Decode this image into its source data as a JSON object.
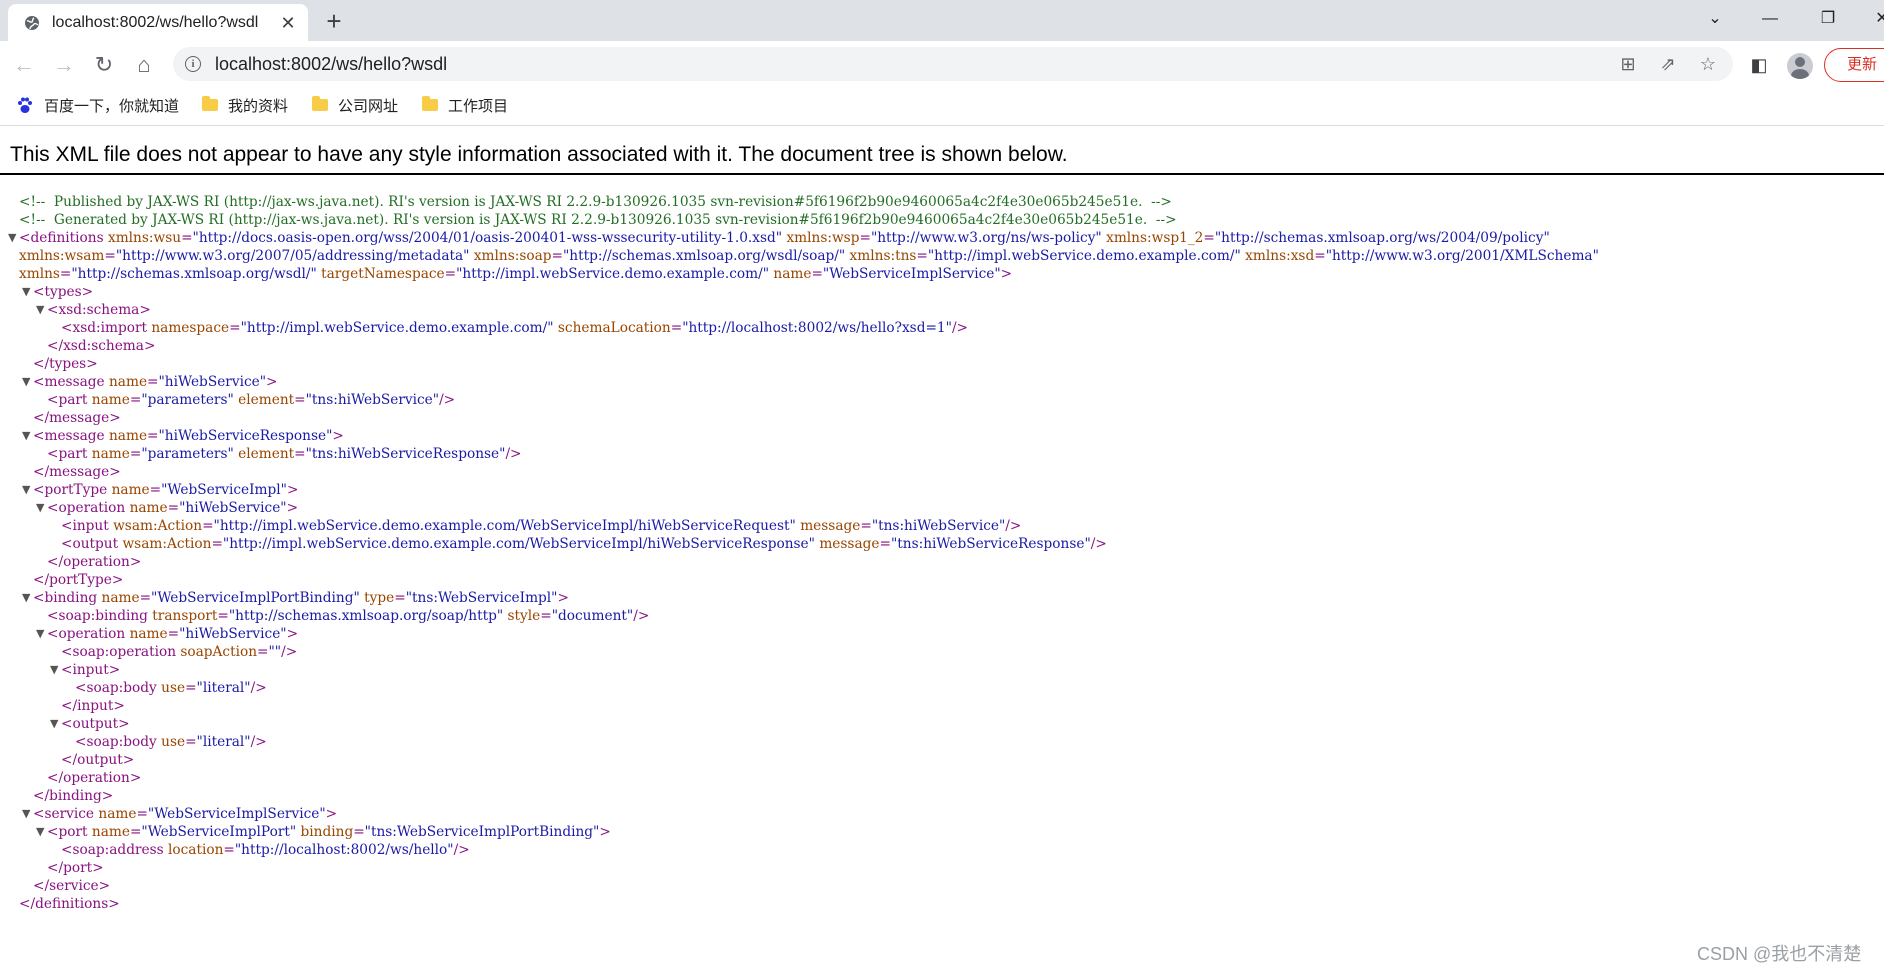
{
  "browser": {
    "tab_title": "localhost:8002/ws/hello?wsdl",
    "url": "localhost:8002/ws/hello?wsdl",
    "update_label": "更新",
    "bookmarks": [
      "百度一下，你就知道",
      "我的资料",
      "公司网址",
      "工作项目"
    ]
  },
  "page": {
    "notice": "This XML file does not appear to have any style information associated with it. The document tree is shown below."
  },
  "xml_lines": [
    "<!--  Published by JAX-WS RI (http://jax-ws.java.net). RI's version is JAX-WS RI 2.2.9-b130926.1035 svn-revision#5f6196f2b90e9460065a4c2f4e30e065b245e51e.  -->",
    "<!--  Generated by JAX-WS RI (http://jax-ws.java.net). RI's version is JAX-WS RI 2.2.9-b130926.1035 svn-revision#5f6196f2b90e9460065a4c2f4e30e065b245e51e.  -->",
    "<definitions xmlns:wsu=\"http://docs.oasis-open.org/wss/2004/01/oasis-200401-wss-wssecurity-utility-1.0.xsd\" xmlns:wsp=\"http://www.w3.org/ns/ws-policy\" xmlns:wsp1_2=\"http://schemas.xmlsoap.org/ws/2004/09/policy\"",
    "xmlns:wsam=\"http://www.w3.org/2007/05/addressing/metadata\" xmlns:soap=\"http://schemas.xmlsoap.org/wsdl/soap/\" xmlns:tns=\"http://impl.webService.demo.example.com/\" xmlns:xsd=\"http://www.w3.org/2001/XMLSchema\"",
    "xmlns=\"http://schemas.xmlsoap.org/wsdl/\" targetNamespace=\"http://impl.webService.demo.example.com/\" name=\"WebServiceImplService\">",
    "<types>",
    "<xsd:schema>",
    "<xsd:import namespace=\"http://impl.webService.demo.example.com/\" schemaLocation=\"http://localhost:8002/ws/hello?xsd=1\"/>",
    "</xsd:schema>",
    "</types>",
    "<message name=\"hiWebService\">",
    "<part name=\"parameters\" element=\"tns:hiWebService\"/>",
    "</message>",
    "<message name=\"hiWebServiceResponse\">",
    "<part name=\"parameters\" element=\"tns:hiWebServiceResponse\"/>",
    "</message>",
    "<portType name=\"WebServiceImpl\">",
    "<operation name=\"hiWebService\">",
    "<input wsam:Action=\"http://impl.webService.demo.example.com/WebServiceImpl/hiWebServiceRequest\" message=\"tns:hiWebService\"/>",
    "<output wsam:Action=\"http://impl.webService.demo.example.com/WebServiceImpl/hiWebServiceResponse\" message=\"tns:hiWebServiceResponse\"/>",
    "</operation>",
    "</portType>",
    "<binding name=\"WebServiceImplPortBinding\" type=\"tns:WebServiceImpl\">",
    "<soap:binding transport=\"http://schemas.xmlsoap.org/soap/http\" style=\"document\"/>",
    "<operation name=\"hiWebService\">",
    "<soap:operation soapAction=\"\"/>",
    "<input>",
    "<soap:body use=\"literal\"/>",
    "</input>",
    "<output>",
    "<soap:body use=\"literal\"/>",
    "</output>",
    "</operation>",
    "</binding>",
    "<service name=\"WebServiceImplService\">",
    "<port name=\"WebServiceImplPort\" binding=\"tns:WebServiceImplPortBinding\">",
    "<soap:address location=\"http://localhost:8002/ws/hello\"/>",
    "</port>",
    "</service>",
    "</definitions>"
  ],
  "watermark": "CSDN @我也不清楚",
  "colors": {
    "comment": "#236e25",
    "tag": "#881280",
    "attr_name": "#994500",
    "attr_value": "#1a1aa6"
  }
}
